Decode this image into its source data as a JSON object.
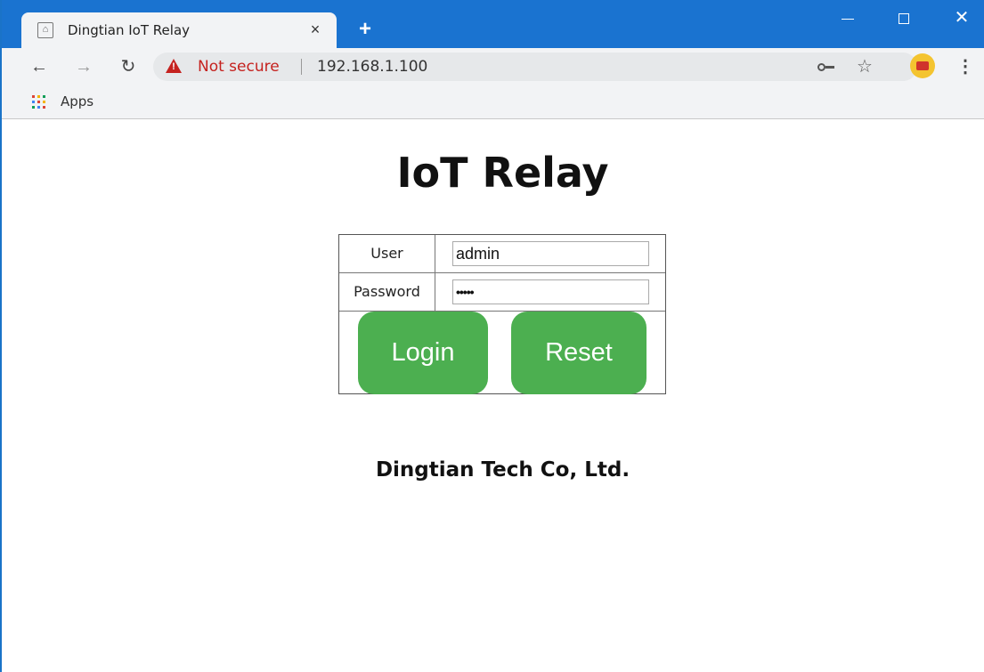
{
  "browser": {
    "tab_title": "Dingtian IoT Relay",
    "tab_close": "×",
    "new_tab": "+",
    "security_label": "Not secure",
    "url": "192.168.1.100",
    "bookmark_apps": "Apps",
    "icons": {
      "tab": "home-icon",
      "back": "arrow-left-icon",
      "forward": "arrow-right-icon",
      "reload": "reload-icon",
      "warning": "warning-icon",
      "key": "key-icon",
      "star": "star-icon",
      "extension": "extension-icon",
      "menu": "kebab-menu-icon",
      "apps": "apps-grid-icon"
    },
    "colors": {
      "titlebar": "#1a73d0",
      "warning": "#c5221f"
    }
  },
  "page": {
    "title": "IoT Relay",
    "user_label": "User",
    "user_value": "admin",
    "password_label": "Password",
    "password_value": "•••••",
    "login_label": "Login",
    "reset_label": "Reset",
    "footer": "Dingtian Tech Co, Ltd.",
    "colors": {
      "button": "#4caf50"
    }
  }
}
